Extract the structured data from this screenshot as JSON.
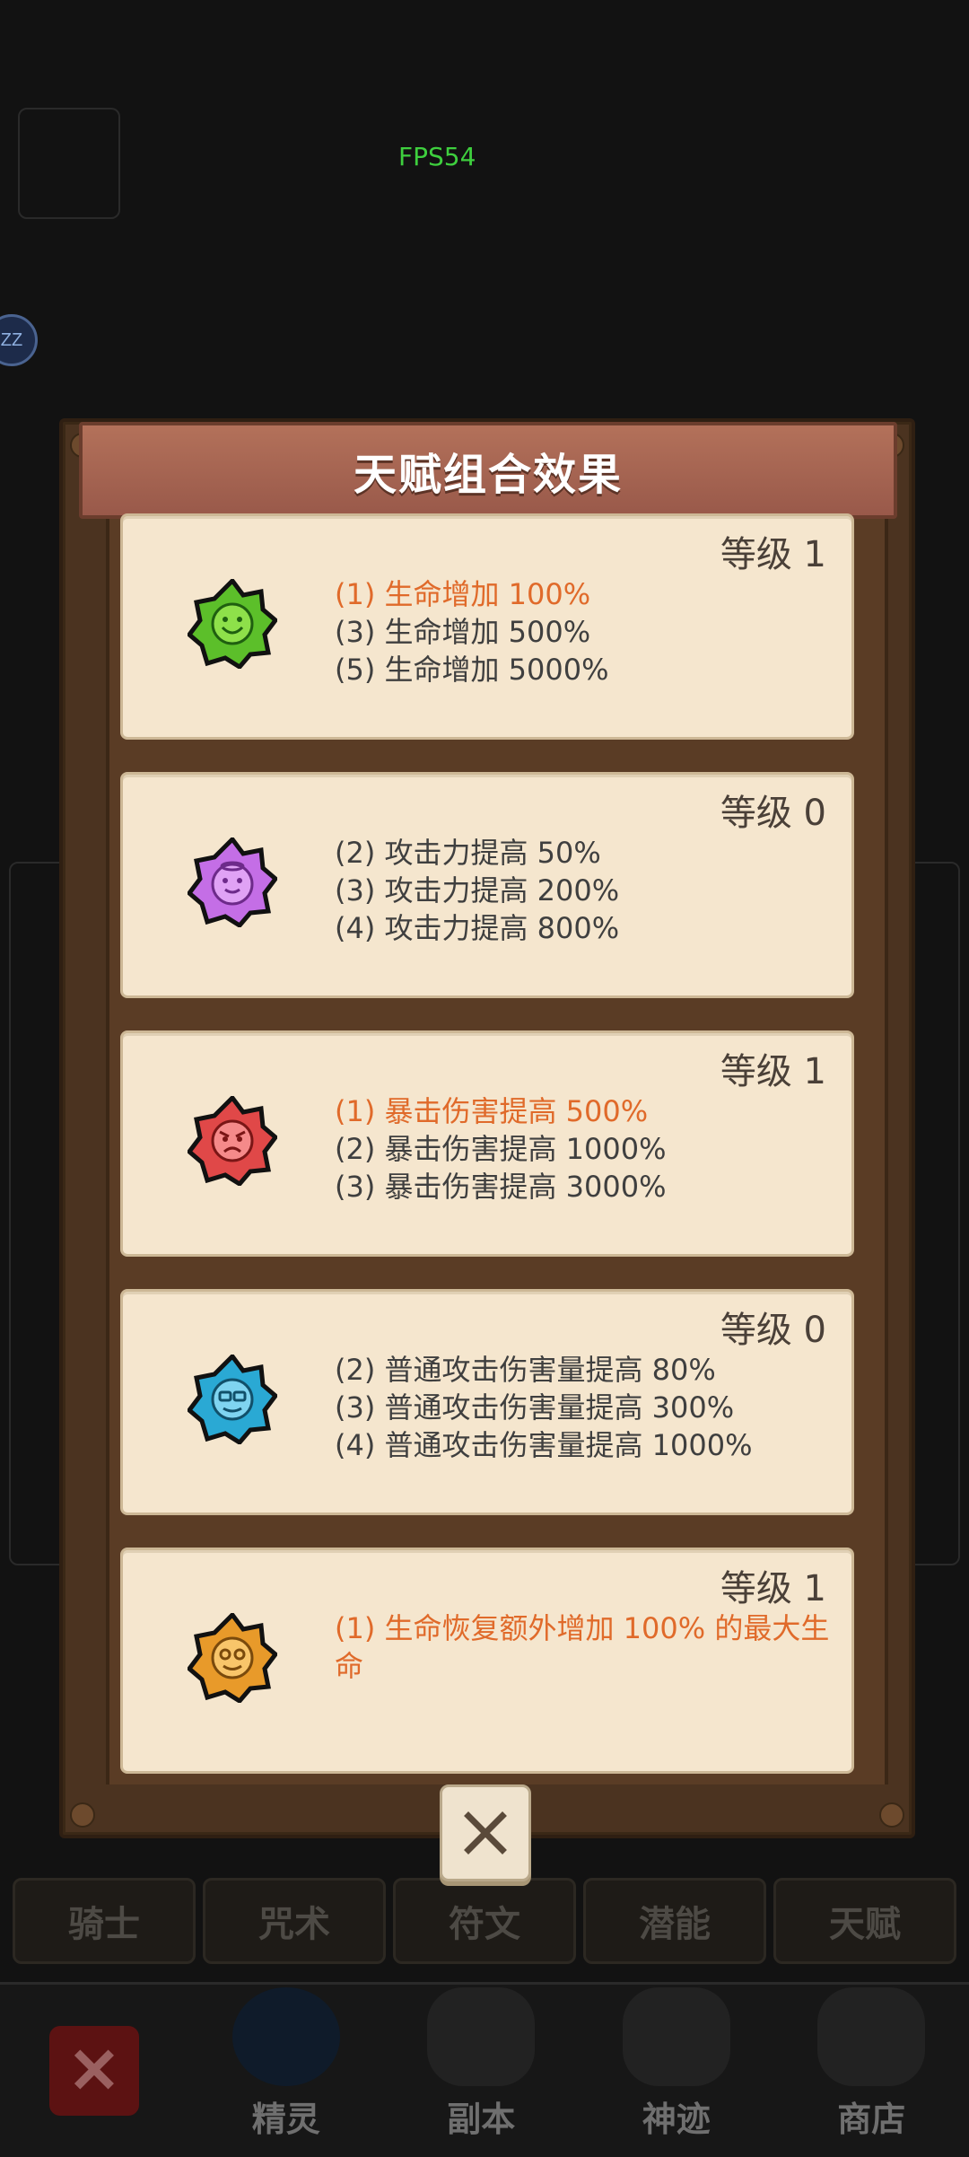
{
  "fps": "FPS54",
  "status_zz": "ZZ",
  "modal": {
    "title": "天赋组合效果",
    "cards": [
      {
        "level": "等级 1",
        "icon": "smile-face-icon",
        "color": "#5cbf2a",
        "lines": [
          {
            "text": "(1) 生命增加 100%",
            "active": true
          },
          {
            "text": "(3) 生命增加 500%",
            "active": false
          },
          {
            "text": "(5) 生命增加 5000%",
            "active": false
          }
        ]
      },
      {
        "level": "等级 0",
        "icon": "angel-face-icon",
        "color": "#c46ee6",
        "lines": [
          {
            "text": "(2) 攻击力提高 50%",
            "active": false
          },
          {
            "text": "(3) 攻击力提高 200%",
            "active": false
          },
          {
            "text": "(4) 攻击力提高 800%",
            "active": false
          }
        ]
      },
      {
        "level": "等级 1",
        "icon": "angry-face-icon",
        "color": "#e04848",
        "lines": [
          {
            "text": "(1) 暴击伤害提高 500%",
            "active": true
          },
          {
            "text": "(2) 暴击伤害提高 1000%",
            "active": false
          },
          {
            "text": "(3) 暴击伤害提高 3000%",
            "active": false
          }
        ]
      },
      {
        "level": "等级 0",
        "icon": "glasses-face-icon",
        "color": "#2aa9d4",
        "lines": [
          {
            "text": "(2) 普通攻击伤害量提高 80%",
            "active": false
          },
          {
            "text": "(3) 普通攻击伤害量提高 300%",
            "active": false
          },
          {
            "text": "(4) 普通攻击伤害量提高 1000%",
            "active": false
          }
        ]
      },
      {
        "level": "等级 1",
        "icon": "heart-eyes-face-icon",
        "color": "#e89a2a",
        "lines": [
          {
            "text": "(1) 生命恢复额外增加 100% 的最大生命",
            "active": true
          }
        ]
      }
    ],
    "close_icon": "close-icon"
  },
  "bottom_tabs": [
    "骑士",
    "咒术",
    "符文",
    "潜能",
    "天赋"
  ],
  "nav": {
    "close_icon": "close-icon",
    "items": [
      "精灵",
      "副本",
      "神迹",
      "商店"
    ]
  }
}
